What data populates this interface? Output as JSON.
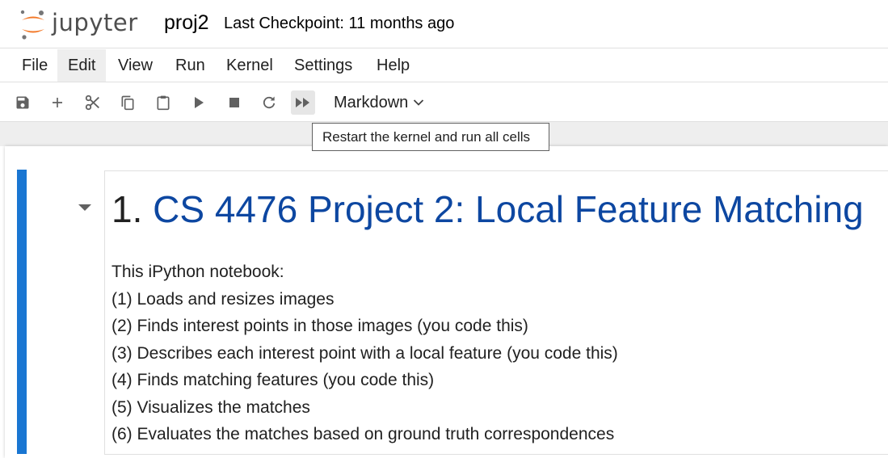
{
  "header": {
    "logo_text": "jupyter",
    "notebook_title": "proj2",
    "checkpoint": "Last Checkpoint: 11 months ago"
  },
  "menu": {
    "items": [
      {
        "label": "File"
      },
      {
        "label": "Edit"
      },
      {
        "label": "View"
      },
      {
        "label": "Run"
      },
      {
        "label": "Kernel"
      },
      {
        "label": "Settings"
      },
      {
        "label": "Help"
      }
    ],
    "active": "Edit"
  },
  "toolbar": {
    "buttons": [
      {
        "icon": "save-icon"
      },
      {
        "icon": "add-cell-icon"
      },
      {
        "icon": "cut-icon"
      },
      {
        "icon": "copy-icon"
      },
      {
        "icon": "paste-icon"
      },
      {
        "icon": "run-icon"
      },
      {
        "icon": "stop-icon"
      },
      {
        "icon": "restart-icon"
      },
      {
        "icon": "fast-forward-icon"
      }
    ],
    "cell_type": "Markdown",
    "tooltip": "Restart the kernel and run all cells"
  },
  "cell": {
    "heading_number": "1.",
    "heading_text": "CS 4476 Project 2: Local Feature Matching",
    "lines": [
      "This iPython notebook:",
      "(1) Loads and resizes images",
      "(2) Finds interest points in those images (you code this)",
      "(3) Describes each interest point with a local feature (you code this)",
      "(4) Finds matching features (you code this)",
      "(5) Visualizes the matches",
      "(6) Evaluates the matches based on ground truth correspondences"
    ]
  },
  "colors": {
    "accent": "#1976d2",
    "heading": "#0d47a1",
    "logo_orange": "#f37726"
  }
}
